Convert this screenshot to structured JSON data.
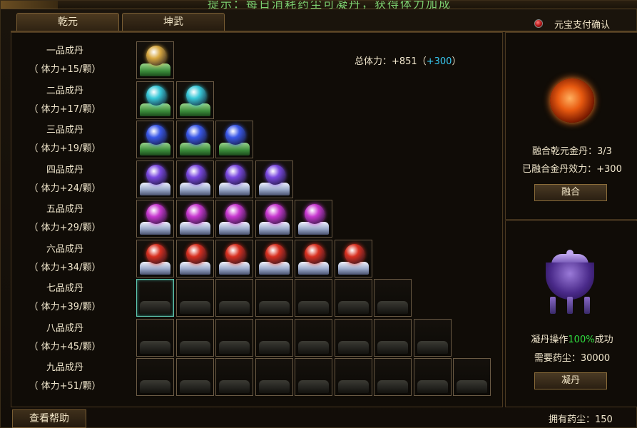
{
  "banner": {
    "text": "提示：每日消耗药尘可凝丹，获得体力加成"
  },
  "tabs": [
    {
      "label": "乾元"
    },
    {
      "label": "坤武"
    }
  ],
  "pay_confirm": {
    "label": "元宝支付确认"
  },
  "total_power": {
    "label": "总体力：+851（",
    "bonus": "+300",
    "suffix": "）"
  },
  "rows": [
    {
      "name": "一品成丹",
      "bonus": "（ 体力+15/颗）",
      "slots": 1,
      "filled": 1,
      "orb_color": "#d8a840",
      "base": "green"
    },
    {
      "name": "二品成丹",
      "bonus": "（ 体力+17/颗）",
      "slots": 2,
      "filled": 2,
      "orb_color": "#38c8d8",
      "base": "green"
    },
    {
      "name": "三品成丹",
      "bonus": "（ 体力+19/颗）",
      "slots": 3,
      "filled": 3,
      "orb_color": "#3a58e8",
      "base": "green"
    },
    {
      "name": "四品成丹",
      "bonus": "（ 体力+24/颗）",
      "slots": 4,
      "filled": 4,
      "orb_color": "#7a48e0",
      "base": "silver"
    },
    {
      "name": "五品成丹",
      "bonus": "（ 体力+29/颗）",
      "slots": 5,
      "filled": 5,
      "orb_color": "#c838d0",
      "base": "silver"
    },
    {
      "name": "六品成丹",
      "bonus": "（ 体力+34/颗）",
      "slots": 6,
      "filled": 6,
      "orb_color": "#d83020",
      "base": "silver"
    },
    {
      "name": "七品成丹",
      "bonus": "（ 体力+39/颗）",
      "slots": 7,
      "filled": 0,
      "orb_color": "",
      "base": "empty"
    },
    {
      "name": "八品成丹",
      "bonus": "（ 体力+45/颗）",
      "slots": 8,
      "filled": 0,
      "orb_color": "",
      "base": "empty"
    },
    {
      "name": "九品成丹",
      "bonus": "（ 体力+51/颗）",
      "slots": 9,
      "filled": 0,
      "orb_color": "",
      "base": "empty"
    }
  ],
  "fusion": {
    "count_label": "融合乾元金丹：3/3",
    "effect_label": "已融合金丹效力：+300",
    "button": "融合"
  },
  "condense": {
    "prefix": "凝丹操作",
    "rate": "100%",
    "suffix": "成功",
    "cost_label": "需要药尘：30000",
    "button": "凝丹"
  },
  "help_button": "查看帮助",
  "dust_owned": "拥有药尘：150"
}
